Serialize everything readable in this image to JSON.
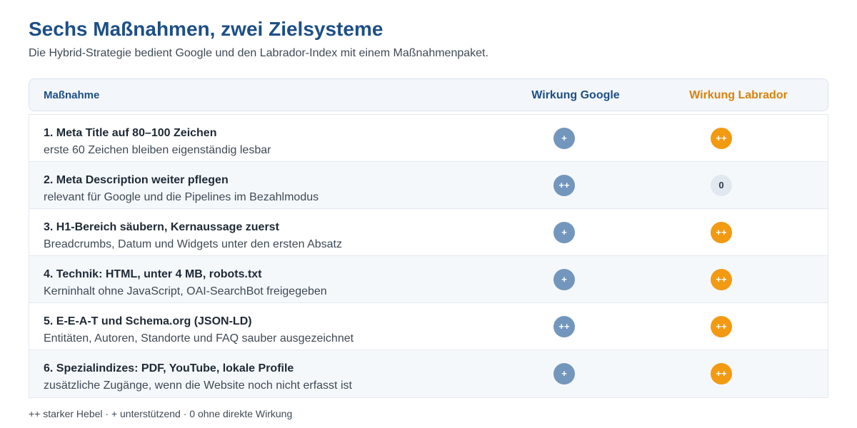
{
  "header": {
    "title": "Sechs Maßnahmen, zwei Zielsysteme",
    "subtitle": "Die Hybrid-Strategie bedient Google und den Labrador-Index mit einem Maßnahmenpaket."
  },
  "table": {
    "columns": {
      "measure": "Maßnahme",
      "google": "Wirkung Google",
      "labrador": "Wirkung Labrador"
    },
    "rows": [
      {
        "title": "1. Meta Title auf 80–100 Zeichen",
        "desc": "erste 60 Zeichen bleiben eigenständig lesbar",
        "google": "+",
        "labrador": "++"
      },
      {
        "title": "2. Meta Description weiter pflegen",
        "desc": "relevant für Google und die Pipelines im Bezahlmodus",
        "google": "++",
        "labrador": "0"
      },
      {
        "title": "3. H1-Bereich säubern, Kernaussage zuerst",
        "desc": "Breadcrumbs, Datum und Widgets unter den ersten Absatz",
        "google": "+",
        "labrador": "++"
      },
      {
        "title": "4. Technik: HTML, unter 4 MB, robots.txt",
        "desc": "Kerninhalt ohne JavaScript, OAI-SearchBot freigegeben",
        "google": "+",
        "labrador": "++"
      },
      {
        "title": "5. E-E-A-T und Schema.org (JSON-LD)",
        "desc": "Entitäten, Autoren, Standorte und FAQ sauber ausgezeichnet",
        "google": "++",
        "labrador": "++"
      },
      {
        "title": "6. Spezialindizes: PDF, YouTube, lokale Profile",
        "desc": "zusätzliche Zugänge, wenn die Website noch nicht erfasst ist",
        "google": "+",
        "labrador": "++"
      }
    ]
  },
  "legend": "++ starker Hebel · + unterstützend · 0 ohne direkte Wirkung",
  "colors": {
    "title": "#1d4f86",
    "google_badge": "#7396bd",
    "labrador_badge": "#f29a12",
    "labrador_header": "#d9820b",
    "neutral_badge": "#e1e8ef"
  }
}
